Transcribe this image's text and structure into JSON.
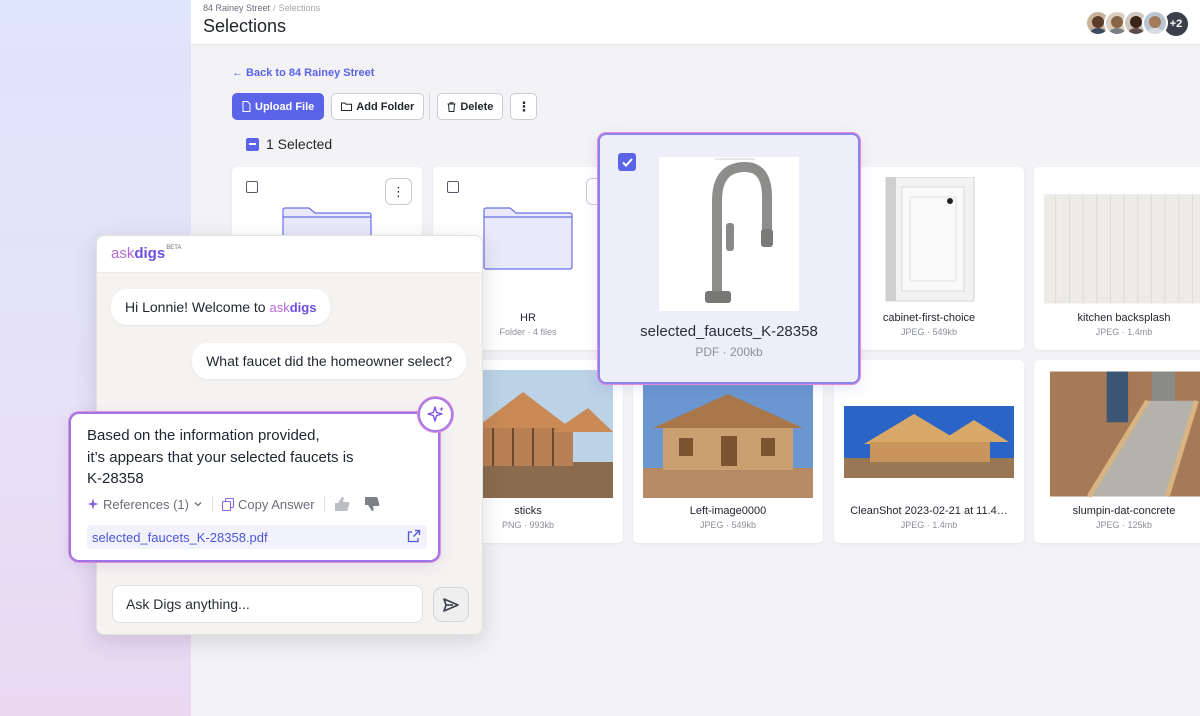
{
  "breadcrumb": {
    "parent": "84 Rainey Street",
    "separator": "/",
    "current": "Selections"
  },
  "page_title": "Selections",
  "avatars": {
    "more_label": "+2"
  },
  "back_link": "← Back to 84 Rainey Street",
  "toolbar": {
    "upload_label": "Upload File",
    "add_folder_label": "Add Folder",
    "delete_label": "Delete",
    "more_label": "⋮"
  },
  "selection": {
    "label": "1 Selected"
  },
  "grid": {
    "folders": [
      {
        "name": "",
        "meta": ""
      },
      {
        "name": "HR",
        "meta": "Folder · 4 files"
      }
    ],
    "files": [
      {
        "name": "cabinet-first-choice",
        "meta": "JPEG · 549kb"
      },
      {
        "name": "kitchen backsplash",
        "meta": "JPEG · 1.4mb"
      },
      {
        "name": "sticks",
        "meta": "PNG · 993kb"
      },
      {
        "name": "Left-image0000",
        "meta": "JPEG · 549kb"
      },
      {
        "name": "CleanShot 2023-02-21 at 11.4…",
        "meta": "JPEG · 1.4mb"
      },
      {
        "name": "slumpin-dat-concrete",
        "meta": "JPEG · 125kb"
      }
    ]
  },
  "selected_file": {
    "name": "selected_faucets_K-28358",
    "meta": "PDF · 200kb"
  },
  "chat": {
    "logo_ask": "ask",
    "logo_digs": "digs",
    "logo_beta": "BETA",
    "welcome_prefix": "Hi Lonnie! Welcome to ",
    "welcome_ask": "ask",
    "welcome_digs": "digs",
    "user_question": "What faucet did the homeowner select?",
    "answer_lines": [
      "Based on the information provided,",
      "it’s appears that your selected faucets is",
      "K-28358"
    ],
    "references_label": "References (1)",
    "copy_label": "Copy Answer",
    "reference_file": "selected_faucets_K-28358.pdf",
    "input_placeholder": "Ask Digs anything..."
  },
  "colors": {
    "accent": "#5b63e8",
    "brand_purple": "#6c4fe0",
    "brand_pink": "#b36ad6",
    "highlight_border": "#9b78e8"
  }
}
